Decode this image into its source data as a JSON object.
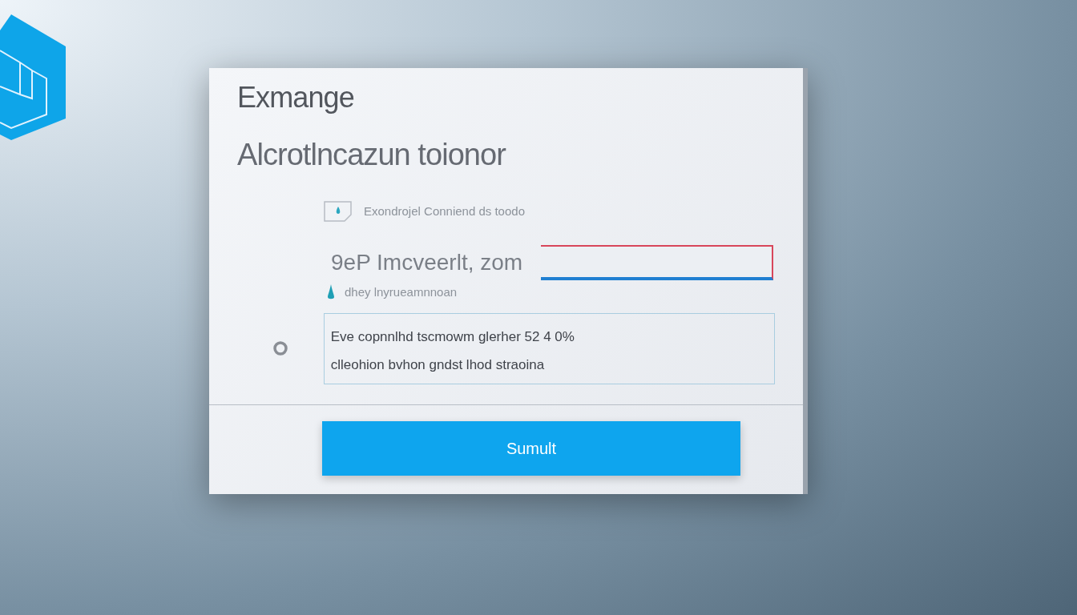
{
  "title": "Exmange",
  "subtitle": "Alcrotlncazun toionor",
  "hint": "Exondrojel Conniend ds toodo",
  "field": {
    "label": "9eP Imcveerlt, zom"
  },
  "note": "dhey lnyrueamnnoan",
  "message": [
    "Eve copnnlhd tscmowm glerher 52 4 0%",
    "clleohion bvhon gndst lhod straoina"
  ],
  "submit": "Sumult"
}
